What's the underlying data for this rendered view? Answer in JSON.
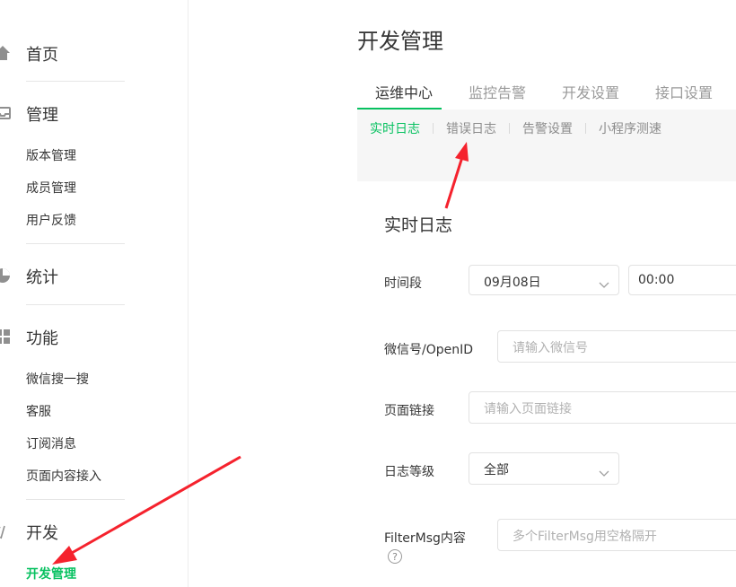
{
  "sidebar": {
    "sections": [
      {
        "label": "首页",
        "icon": "home-icon"
      },
      {
        "label": "管理",
        "icon": "inbox-icon",
        "items": [
          "版本管理",
          "成员管理",
          "用户反馈"
        ]
      },
      {
        "label": "统计",
        "icon": "pie-chart-icon"
      },
      {
        "label": "功能",
        "icon": "grid-icon",
        "items": [
          "微信搜一搜",
          "客服",
          "订阅消息",
          "页面内容接入"
        ]
      },
      {
        "label": "开发",
        "icon": "code-icon",
        "items": [
          "开发管理"
        ]
      }
    ],
    "active_item": "开发管理"
  },
  "page_title": "开发管理",
  "tabs": [
    "运维中心",
    "监控告警",
    "开发设置",
    "接口设置"
  ],
  "active_tab": "运维中心",
  "subtabs": [
    "实时日志",
    "错误日志",
    "告警设置",
    "小程序测速"
  ],
  "active_subtab": "实时日志",
  "panel": {
    "title": "实时日志",
    "time_range": {
      "label": "时间段",
      "date": "09月08日",
      "time": "00:00"
    },
    "wechat_id": {
      "label": "微信号/OpenID",
      "placeholder": "请输入微信号"
    },
    "page_link": {
      "label": "页面链接",
      "placeholder": "请输入页面链接"
    },
    "log_level": {
      "label": "日志等级",
      "value": "全部"
    },
    "filter_msg": {
      "label": "FilterMsg内容",
      "placeholder": "多个FilterMsg用空格隔开",
      "help": "?"
    }
  },
  "colors": {
    "accent": "#07c160",
    "annotation_arrow": "#f5222d"
  }
}
